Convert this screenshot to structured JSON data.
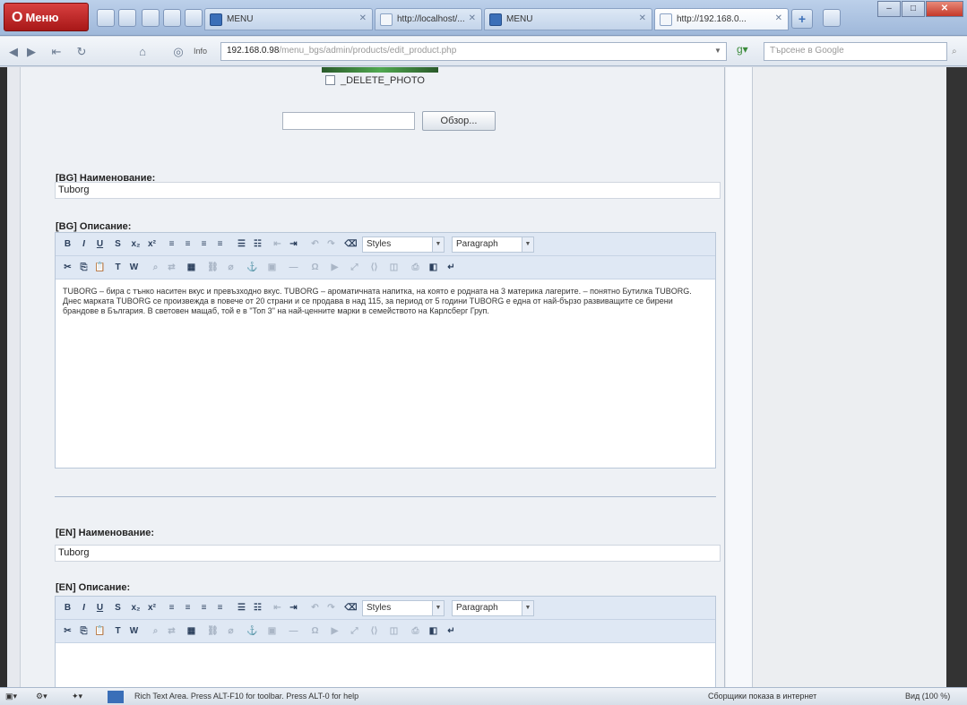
{
  "browser": {
    "menu_label": "Меню",
    "tabs": [
      {
        "label": "MENU",
        "active": false,
        "icon": "page-favicon"
      },
      {
        "label": "http://localhost/...",
        "active": false,
        "icon": "page-favicon"
      },
      {
        "label": "MENU",
        "active": false,
        "icon": "page-favicon"
      },
      {
        "label": "http://192.168.0...",
        "active": true,
        "icon": "page-favicon"
      }
    ],
    "address": {
      "host": "192.168.0.98",
      "path": "/menu_bgs/admin/products/edit_product.php",
      "page_info": "Info"
    },
    "search_placeholder": "Търсене в Google",
    "colors": {
      "accent": "#3b6fb8",
      "opera_red": "#c42020"
    }
  },
  "form": {
    "delete_photo_label": "_DELETE_PHOTO",
    "browse_label": "Обзор...",
    "bg_name_label": "[BG] Наименование:",
    "bg_name_value": "Tuborg",
    "bg_desc_label": "[BG] Описание:",
    "bg_desc_text": "TUBORG – бира с тънко наситен вкус и превъзходно вкус. TUBORG – ароматичната напитка, на която е родната на 3 материка лагерите. – понятно Бутилка TUBORG. Днес марката TUBORG се произвежда в повече от 20 страни и се продава в над 115, за период от 5 години TUBORG е една от най-бързо развиващите се бирени брандове в България. В световен мащаб, той е в \"Топ 3\" на най-ценните марки в семейството на Карлсберг Груп.",
    "en_name_label": "[EN] Наименование:",
    "en_name_value": "Tuborg",
    "en_desc_label": "[EN] Описание:",
    "editor_styles": "Styles",
    "editor_paragraph": "Paragraph"
  },
  "status": {
    "message": "Rich Text Area. Press ALT-F10 for toolbar. Press ALT-0 for help",
    "right_text": "Сборщики показа в интернет",
    "zoom": "Вид (100 %)"
  }
}
